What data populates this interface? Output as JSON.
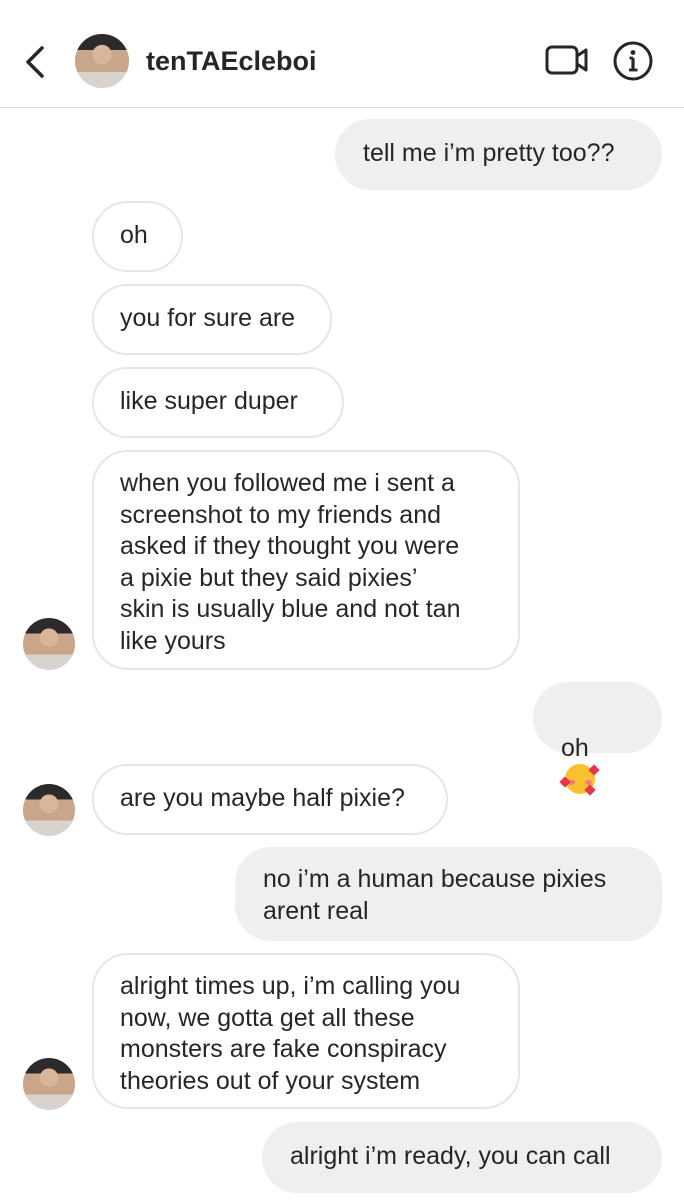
{
  "header": {
    "username": "tenTAEcleboi",
    "back_icon": "chevron-left-icon",
    "video_icon": "video-camera-icon",
    "info_icon": "info-icon"
  },
  "messages": [
    {
      "side": "out",
      "text": "tell me i’m pretty too??"
    },
    {
      "side": "in",
      "text": "oh"
    },
    {
      "side": "in",
      "text": "you for sure are"
    },
    {
      "side": "in",
      "text": "like super duper"
    },
    {
      "side": "in",
      "text": "when you followed me i sent a\nscreenshot to my friends and\nasked if they thought you were\na pixie but they said pixies’\nskin is usually blue and not tan\nlike yours"
    },
    {
      "side": "out",
      "text": "oh",
      "emoji": "smiling-face-with-hearts"
    },
    {
      "side": "in",
      "text": "are you maybe half pixie?"
    },
    {
      "side": "out",
      "text": "no i’m a human because pixies\narent real"
    },
    {
      "side": "in",
      "text": "alright times up, i’m calling you\nnow, we gotta get all these\nmonsters are fake conspiracy\ntheories out of your system"
    },
    {
      "side": "out",
      "text": "alright i’m ready, you can call"
    }
  ]
}
